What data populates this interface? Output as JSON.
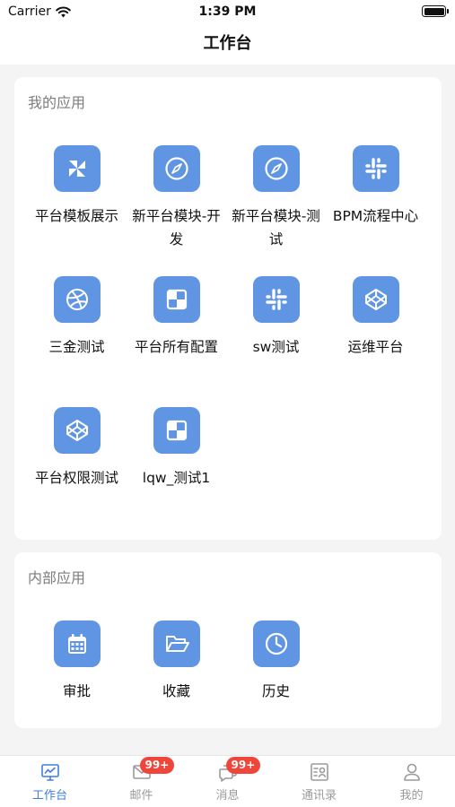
{
  "status_bar": {
    "carrier": "Carrier",
    "time": "1:39 PM"
  },
  "header": {
    "title": "工作台"
  },
  "my_apps": {
    "title": "我的应用",
    "items": [
      {
        "label": "平台模板展示",
        "icon": "pinwheel-icon"
      },
      {
        "label": "新平台模块-开发",
        "icon": "compass-icon"
      },
      {
        "label": "新平台模块-测试",
        "icon": "compass-icon"
      },
      {
        "label": "BPM流程中心",
        "icon": "slack-icon"
      },
      {
        "label": "三金测试",
        "icon": "dribbble-icon"
      },
      {
        "label": "平台所有配置",
        "icon": "grid-squares-icon"
      },
      {
        "label": "sw测试",
        "icon": "slack-icon"
      },
      {
        "label": "运维平台",
        "icon": "codepen-icon"
      },
      {
        "label": "平台权限测试",
        "icon": "codepen-icon"
      },
      {
        "label": "lqw_测试1",
        "icon": "grid-squares-icon"
      }
    ]
  },
  "internal_apps": {
    "title": "内部应用",
    "items": [
      {
        "label": "审批",
        "icon": "calendar-icon"
      },
      {
        "label": "收藏",
        "icon": "folder-open-icon"
      },
      {
        "label": "历史",
        "icon": "clock-icon"
      }
    ]
  },
  "tab_bar": {
    "tabs": [
      {
        "label": "工作台",
        "icon": "monitor-icon",
        "active": true,
        "badge": ""
      },
      {
        "label": "邮件",
        "icon": "mail-icon",
        "active": false,
        "badge": "99+"
      },
      {
        "label": "消息",
        "icon": "message-icon",
        "active": false,
        "badge": "99+"
      },
      {
        "label": "通讯录",
        "icon": "contacts-icon",
        "active": false,
        "badge": ""
      },
      {
        "label": "我的",
        "icon": "user-icon",
        "active": false,
        "badge": ""
      }
    ]
  },
  "colors": {
    "icon_bg": "#5f95e3",
    "accent": "#3f7ee0",
    "badge": "#f0453a"
  }
}
